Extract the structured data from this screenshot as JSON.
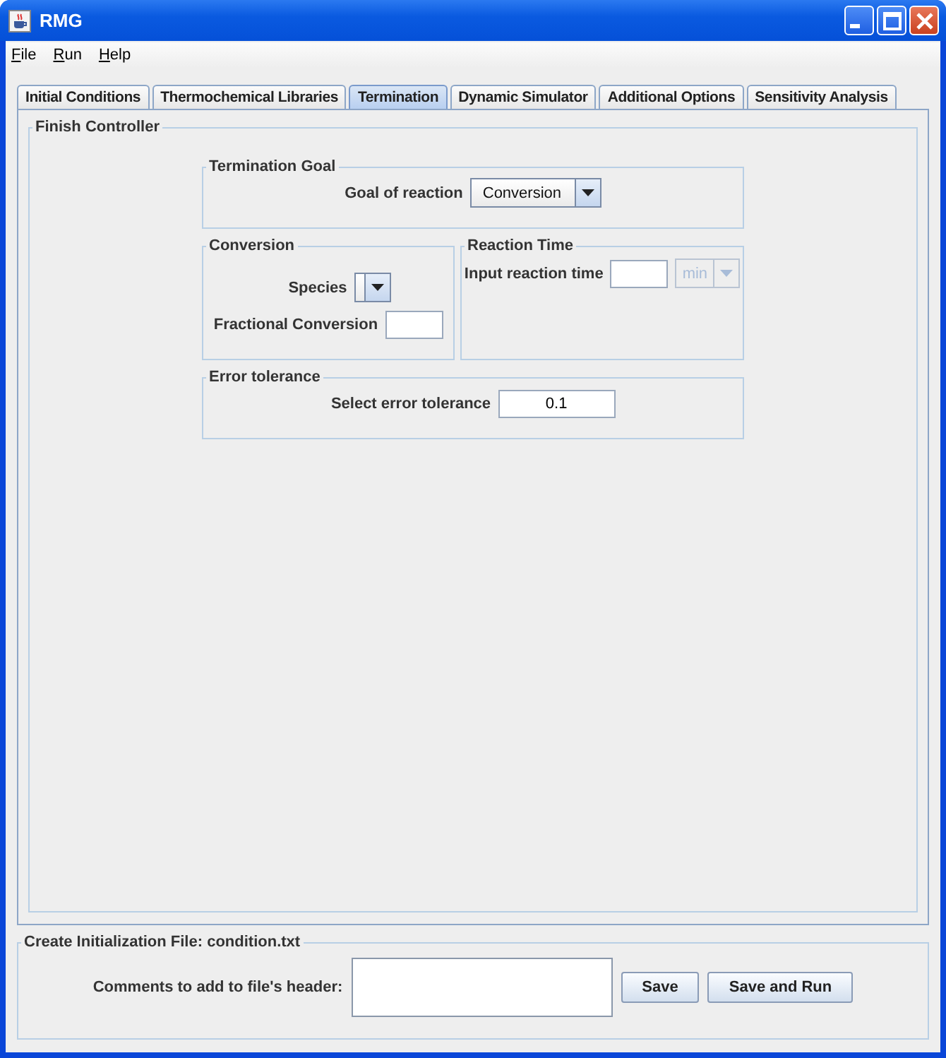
{
  "window": {
    "title": "RMG"
  },
  "menu": [
    {
      "label": "File"
    },
    {
      "label": "Run"
    },
    {
      "label": "Help"
    }
  ],
  "tabs": [
    {
      "label": "Initial Conditions",
      "selected": false
    },
    {
      "label": "Thermochemical Libraries",
      "selected": false
    },
    {
      "label": "Termination",
      "selected": true
    },
    {
      "label": "Dynamic Simulator",
      "selected": false
    },
    {
      "label": "Additional Options",
      "selected": false
    },
    {
      "label": "Sensitivity Analysis",
      "selected": false
    }
  ],
  "finish_controller": {
    "title": "Finish Controller",
    "termination_goal": {
      "title": "Termination Goal",
      "label": "Goal of reaction",
      "value": "Conversion"
    },
    "conversion": {
      "title": "Conversion",
      "species_label": "Species",
      "fraction_label": "Fractional Conversion"
    },
    "reaction_time": {
      "title": "Reaction Time",
      "label": "Input reaction time",
      "unit": {
        "value": "min",
        "disabled": true
      }
    },
    "error_tolerance": {
      "title": "Error tolerance",
      "label": "Select error tolerance",
      "value": "0.1"
    }
  },
  "init_file": {
    "title": "Create Initialization File: condition.txt",
    "label": "Comments to add to file's header:",
    "buttons": [
      "Save",
      "Save and Run"
    ]
  }
}
